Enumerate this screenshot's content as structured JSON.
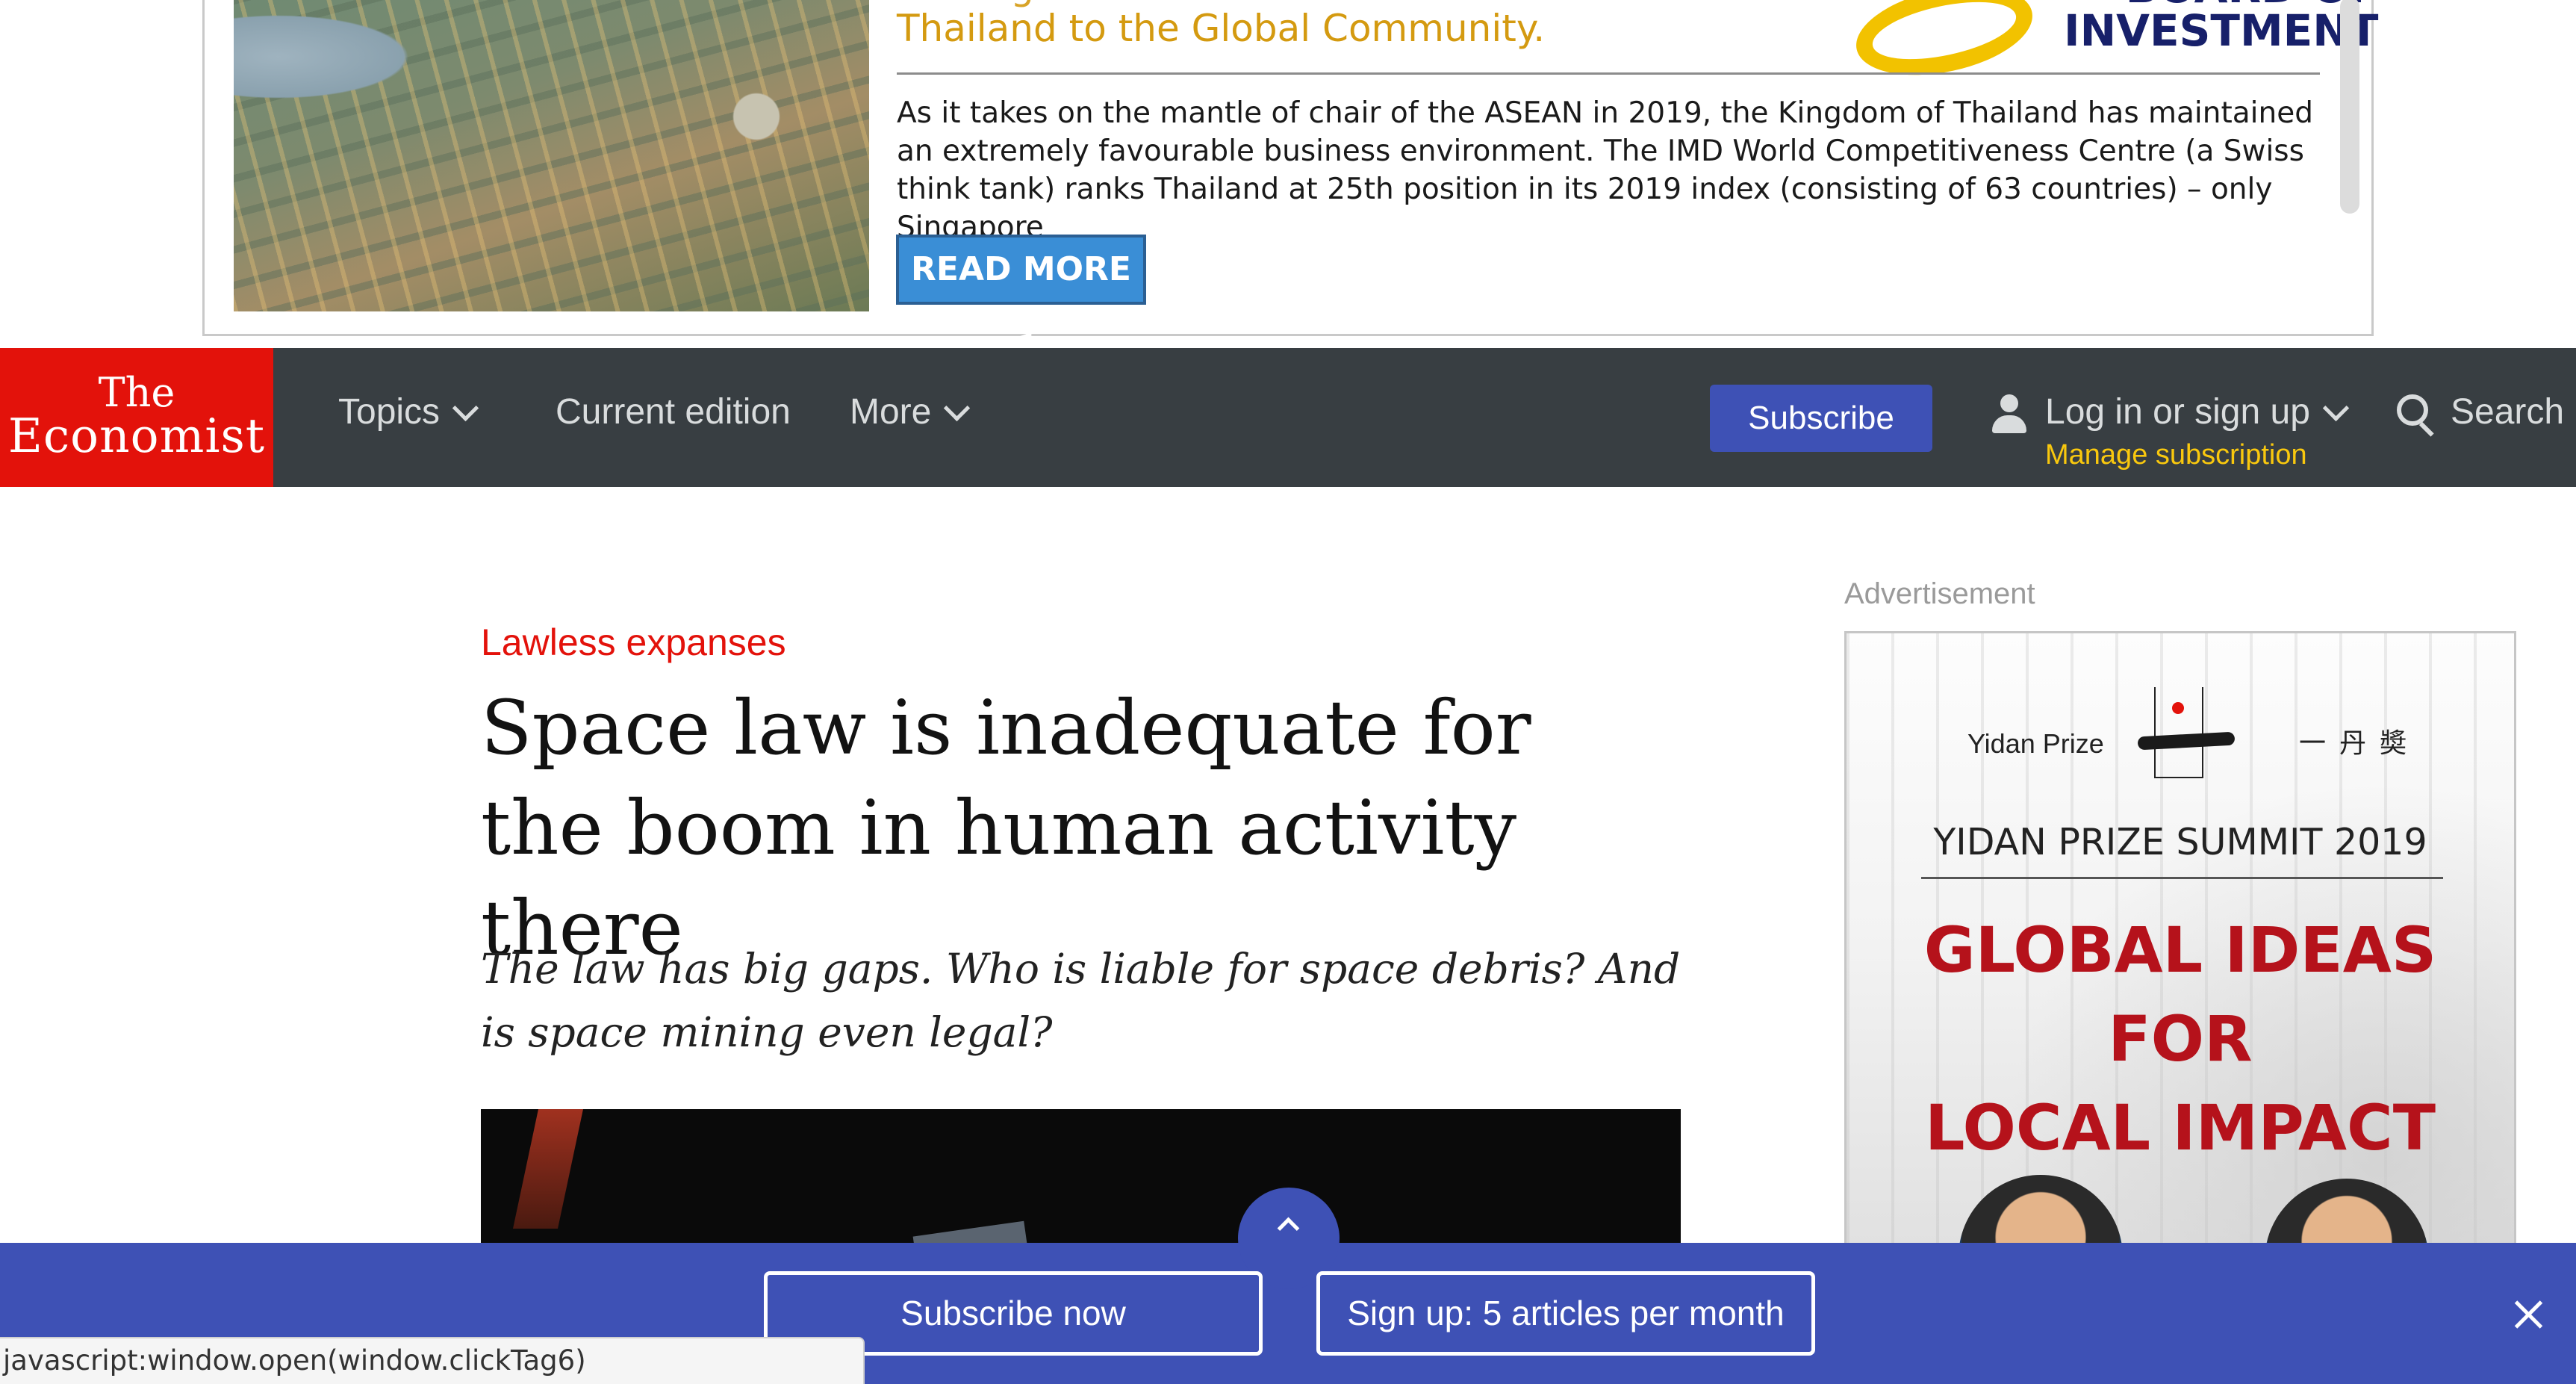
{
  "top_ad": {
    "headline_cut": "Reinvigorates ASEAN and Connects",
    "headline": "Thailand to the Global Community.",
    "logo_text_line1": "BOARD OF",
    "logo_text_line2": "INVESTMENT",
    "body": "As it takes on the mantle of chair of the ASEAN in 2019, the Kingdom of Thailand has maintained an extremely favourable business environment. The IMD World Competitiveness Centre (a Swiss think tank) ranks Thailand at 25th position in its 2019 index (consisting of 63 countries) – only Singapore",
    "cta": "READ MORE >",
    "colors": {
      "headline": "#d49a10",
      "button": "#3a8ed6",
      "logo_ring": "#f2c200",
      "logo_text": "#17206a"
    }
  },
  "navbar": {
    "logo_line1": "The",
    "logo_line2": "Economist",
    "items": [
      {
        "label": "Topics",
        "has_dropdown": true
      },
      {
        "label": "Current edition",
        "has_dropdown": false
      },
      {
        "label": "More",
        "has_dropdown": true
      }
    ],
    "subscribe": "Subscribe",
    "login": "Log in or sign up",
    "manage_subscription": "Manage subscription",
    "search": "Search",
    "colors": {
      "background": "#383e42",
      "logo_bg": "#e3120b",
      "subscribe_bg": "#3e51b5",
      "manage": "#f9c80e"
    },
    "icons": [
      "chevron-down-icon",
      "user-icon",
      "search-icon"
    ]
  },
  "article": {
    "flytitle": "Lawless expanses",
    "headline": "Space law is inadequate for the boom in human activity there",
    "rubric": "The law has big gaps. Who is liable for space debris? And is space mining even legal?"
  },
  "sidebar_ad": {
    "label": "Advertisement",
    "brand_left": "Yidan Prize",
    "brand_right": "一丹奬",
    "summit": "YIDAN PRIZE SUMMIT 2019",
    "lines": [
      "GLOBAL IDEAS",
      "FOR",
      "LOCAL IMPACT"
    ],
    "colors": {
      "headline": "#b5121b"
    }
  },
  "bottom_bar": {
    "subscribe_now": "Subscribe now",
    "signup": "Sign up: 5 articles per month",
    "icons": [
      "chevron-up-icon",
      "close-icon"
    ],
    "colors": {
      "background": "#3e51b5"
    }
  },
  "status_bar": {
    "url": "javascript:window.open(window.clickTag6)"
  }
}
